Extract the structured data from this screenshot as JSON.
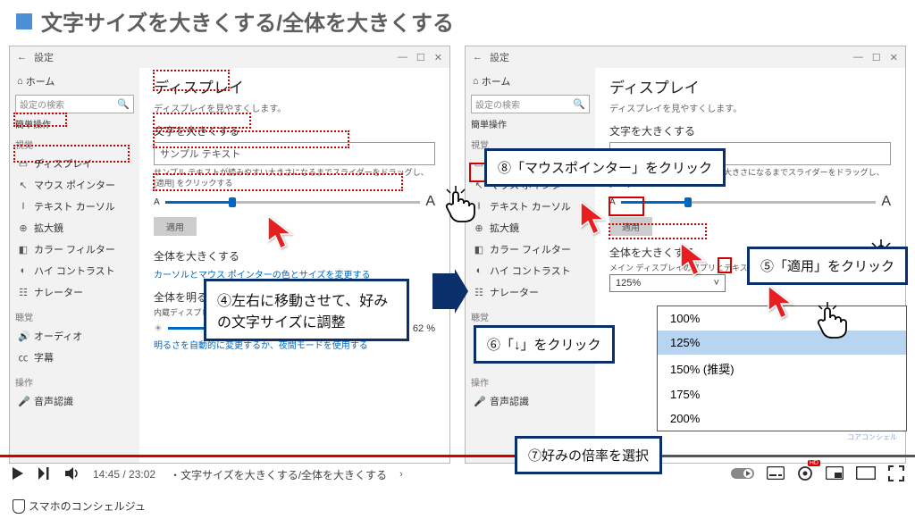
{
  "header": {
    "title": "文字サイズを大きくする/全体を大きくする"
  },
  "settings_window": {
    "title": "設定",
    "home": "ホーム",
    "search_placeholder": "設定の検索",
    "section_label": "簡単操作",
    "cat_vision": "視覚",
    "cat_hearing": "聴覚",
    "cat_interaction": "操作",
    "items": {
      "display": "ディスプレイ",
      "mouse": "マウス ポインター",
      "text_cursor": "テキスト カーソル",
      "magnifier": "拡大鏡",
      "color_filter": "カラー フィルター",
      "high_contrast": "ハイ コントラスト",
      "narrator": "ナレーター",
      "audio": "オーディオ",
      "caption": "字幕",
      "speech": "音声認識"
    }
  },
  "main_panel": {
    "h2": "ディスプレイ",
    "desc": "ディスプレイを見やすくします。",
    "h3_bigger_text": "文字を大きくする",
    "sample": "サンプル テキスト",
    "hint": "サンプル テキストが読みやすい大きさになるまでスライダーをドラッグし、[適用] をクリックする",
    "apply": "適用",
    "h3_bigger_all": "全体を大きくする",
    "scale_hint": "メイン ディスプレイのアプリとテキストのサイズを変更する",
    "scale_value": "125%",
    "cursor_link": "カーソルとマウス ポインターの色とサイズを変更する",
    "h3_brightness": "全体を明るくする",
    "brightness_hint": "内蔵ディスプレイの明るさを変更する",
    "brightness_value": "62 %",
    "night_link": "明るさを自動的に変更するか、夜間モードを使用する"
  },
  "dropdown": {
    "opt1": "100%",
    "opt2": "125%",
    "opt3": "150% (推奨)",
    "opt4": "175%",
    "opt5": "200%"
  },
  "callouts": {
    "c4": "④左右に移動させて、好みの文字サイズに調整",
    "c5": "⑤「適用」をクリック",
    "c6": "⑥「↓」をクリック",
    "c7": "⑦好みの倍率を選択",
    "c8": "⑧「マウスポインター」をクリック"
  },
  "player": {
    "time_current": "14:45",
    "time_total": "23:02",
    "chapter": "・文字サイズを大きくする/全体を大きくする",
    "hd": "HD"
  },
  "branding": "スマホのコンシェルジュ",
  "corner": "コアコンシェル"
}
